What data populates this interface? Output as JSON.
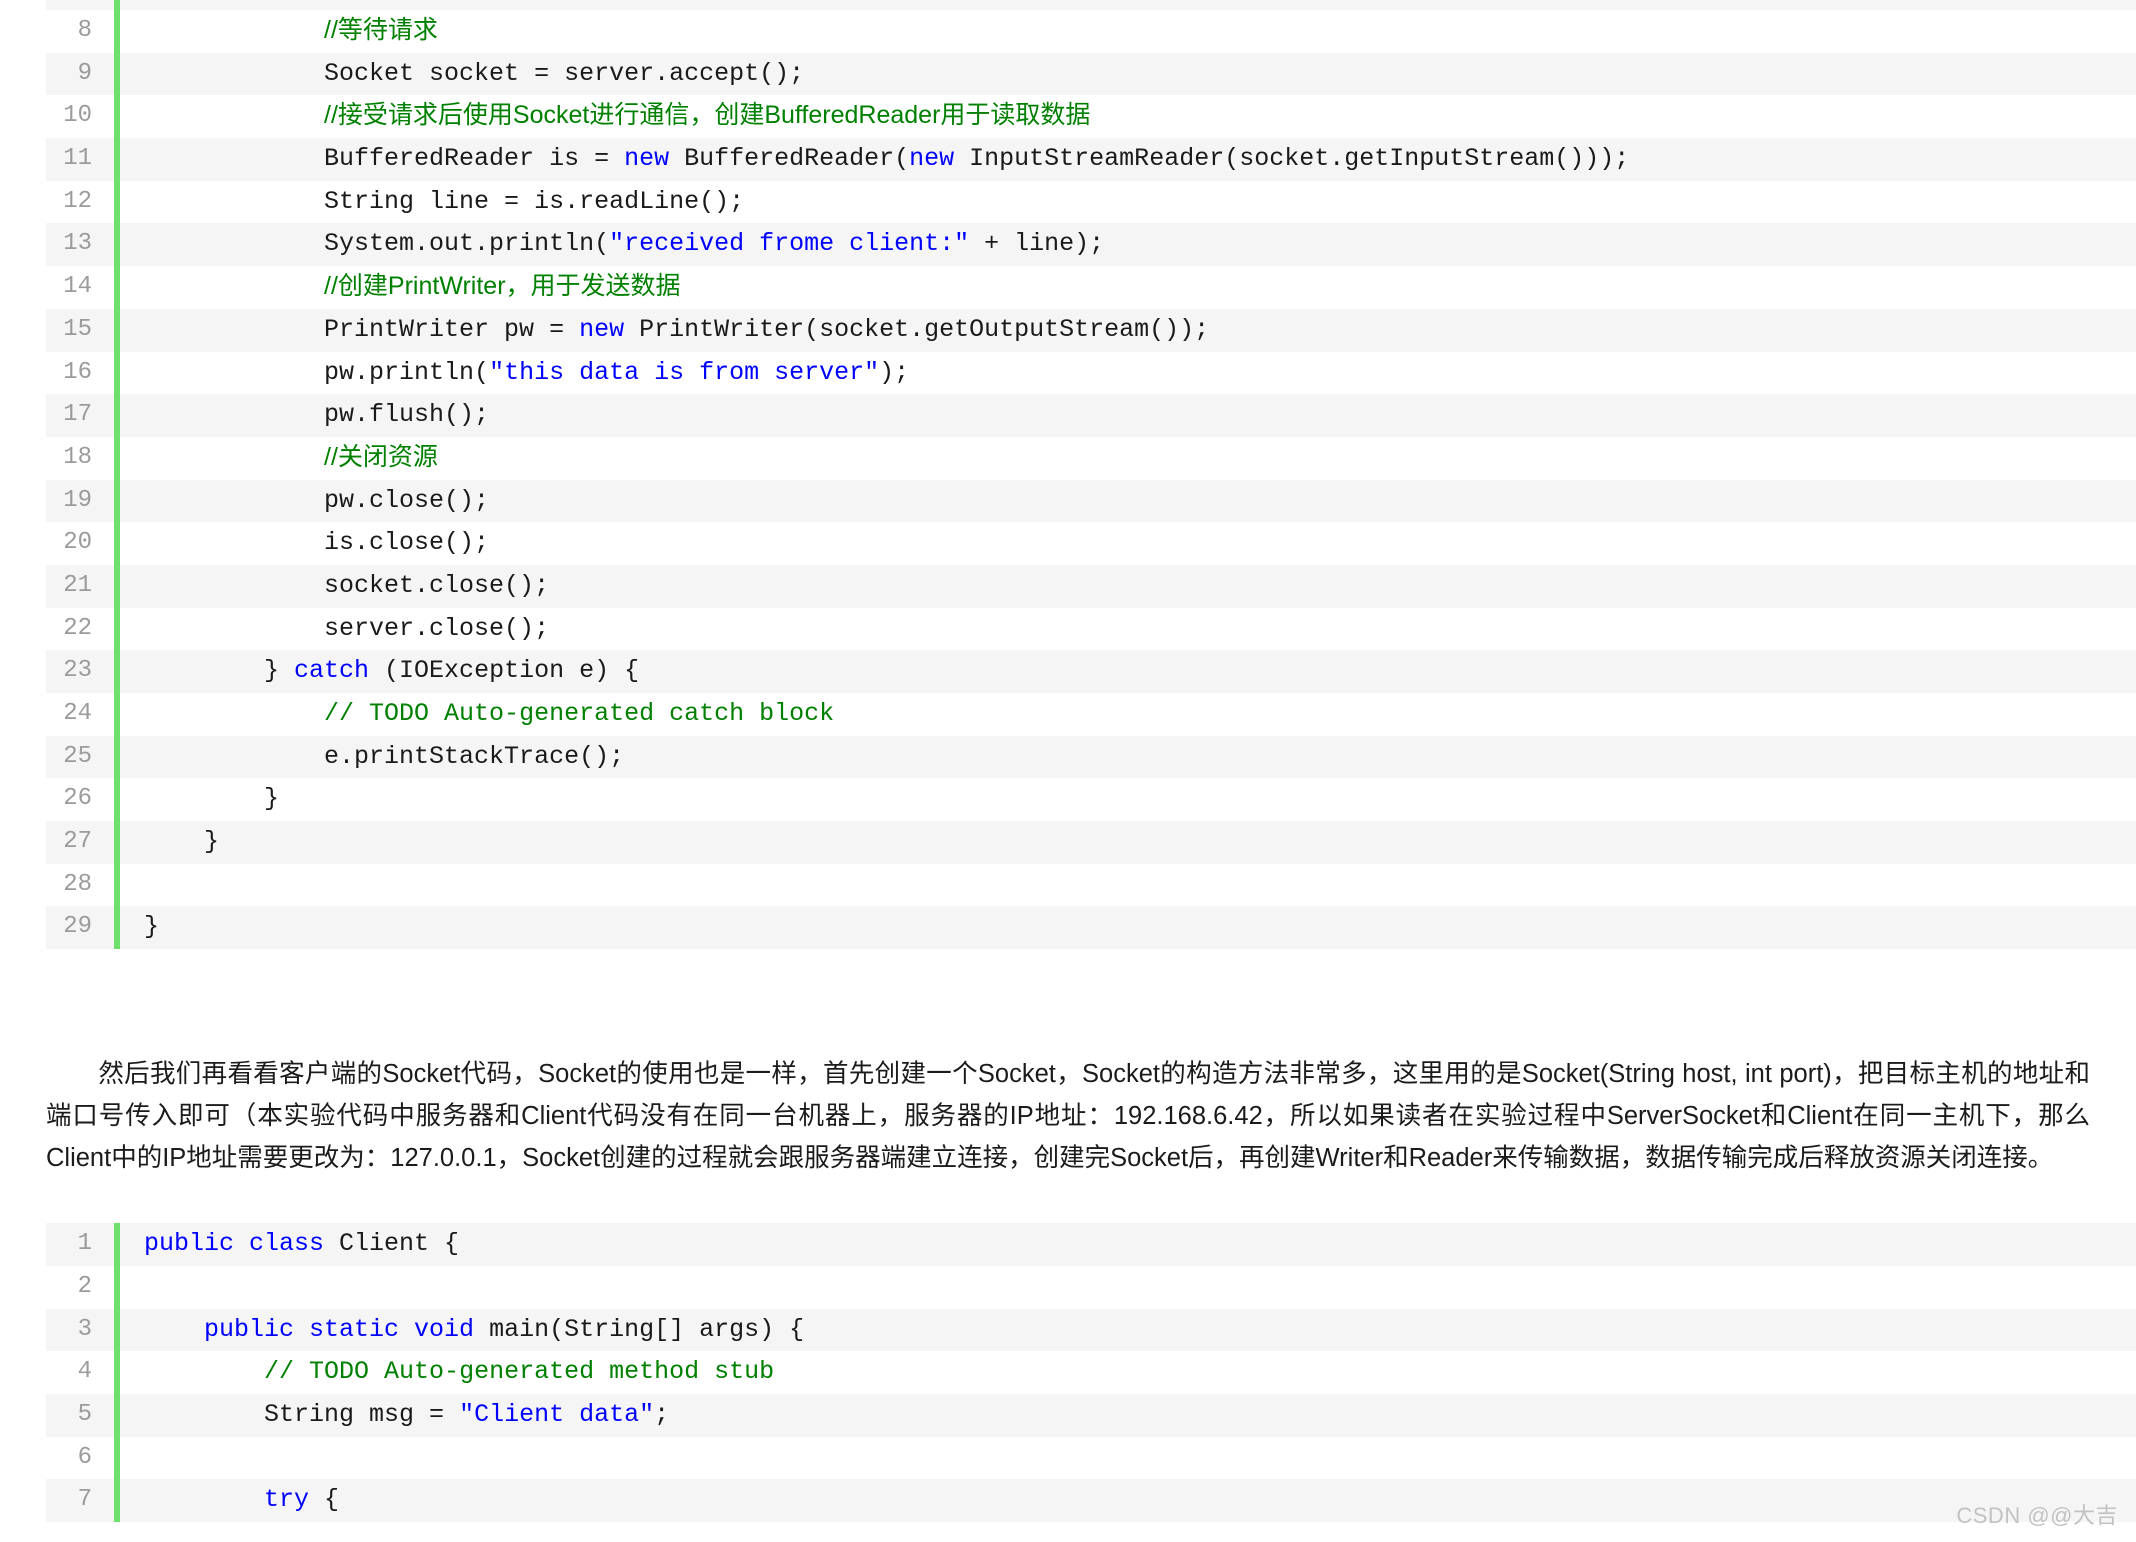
{
  "document": {
    "watermark": "CSDN @@大吉"
  },
  "code_block_server": {
    "language": "java",
    "clipped_top_line": true,
    "lines": [
      {
        "num": "8",
        "segments": [
          {
            "t": "            ",
            "c": "plain"
          },
          {
            "t": "//等待请求",
            "c": "cmt-cn"
          }
        ]
      },
      {
        "num": "9",
        "segments": [
          {
            "t": "            Socket socket = server.accept();",
            "c": "plain"
          }
        ]
      },
      {
        "num": "10",
        "segments": [
          {
            "t": "            ",
            "c": "plain"
          },
          {
            "t": "//接受请求后使用Socket进行通信，创建BufferedReader用于读取数据",
            "c": "cmt-cn"
          }
        ]
      },
      {
        "num": "11",
        "segments": [
          {
            "t": "            BufferedReader is = ",
            "c": "plain"
          },
          {
            "t": "new",
            "c": "kw"
          },
          {
            "t": " BufferedReader(",
            "c": "plain"
          },
          {
            "t": "new",
            "c": "kw"
          },
          {
            "t": " InputStreamReader(socket.getInputStream()));",
            "c": "plain"
          }
        ]
      },
      {
        "num": "12",
        "segments": [
          {
            "t": "            String line = is.readLine();",
            "c": "plain"
          }
        ]
      },
      {
        "num": "13",
        "segments": [
          {
            "t": "            System.out.println(",
            "c": "plain"
          },
          {
            "t": "\"received frome client:\"",
            "c": "str"
          },
          {
            "t": " + line);",
            "c": "plain"
          }
        ]
      },
      {
        "num": "14",
        "segments": [
          {
            "t": "            ",
            "c": "plain"
          },
          {
            "t": "//创建PrintWriter，用于发送数据",
            "c": "cmt-cn"
          }
        ]
      },
      {
        "num": "15",
        "segments": [
          {
            "t": "            PrintWriter pw = ",
            "c": "plain"
          },
          {
            "t": "new",
            "c": "kw"
          },
          {
            "t": " PrintWriter(socket.getOutputStream());",
            "c": "plain"
          }
        ]
      },
      {
        "num": "16",
        "segments": [
          {
            "t": "            pw.println(",
            "c": "plain"
          },
          {
            "t": "\"this data is from server\"",
            "c": "str"
          },
          {
            "t": ");",
            "c": "plain"
          }
        ]
      },
      {
        "num": "17",
        "segments": [
          {
            "t": "            pw.flush();",
            "c": "plain"
          }
        ]
      },
      {
        "num": "18",
        "segments": [
          {
            "t": "            ",
            "c": "plain"
          },
          {
            "t": "//关闭资源",
            "c": "cmt-cn"
          }
        ]
      },
      {
        "num": "19",
        "segments": [
          {
            "t": "            pw.close();",
            "c": "plain"
          }
        ]
      },
      {
        "num": "20",
        "segments": [
          {
            "t": "            is.close();",
            "c": "plain"
          }
        ]
      },
      {
        "num": "21",
        "segments": [
          {
            "t": "            socket.close();",
            "c": "plain"
          }
        ]
      },
      {
        "num": "22",
        "segments": [
          {
            "t": "            server.close();",
            "c": "plain"
          }
        ]
      },
      {
        "num": "23",
        "segments": [
          {
            "t": "        } ",
            "c": "plain"
          },
          {
            "t": "catch",
            "c": "kw"
          },
          {
            "t": " (IOException e) {",
            "c": "plain"
          }
        ]
      },
      {
        "num": "24",
        "segments": [
          {
            "t": "            ",
            "c": "plain"
          },
          {
            "t": "// TODO Auto-generated catch block",
            "c": "cmt"
          }
        ]
      },
      {
        "num": "25",
        "segments": [
          {
            "t": "            e.printStackTrace();",
            "c": "plain"
          }
        ]
      },
      {
        "num": "26",
        "segments": [
          {
            "t": "        }",
            "c": "plain"
          }
        ]
      },
      {
        "num": "27",
        "segments": [
          {
            "t": "    }",
            "c": "plain"
          }
        ]
      },
      {
        "num": "28",
        "segments": [
          {
            "t": "",
            "c": "plain"
          }
        ]
      },
      {
        "num": "29",
        "segments": [
          {
            "t": "}",
            "c": "plain"
          }
        ]
      }
    ]
  },
  "paragraph": {
    "indent": true,
    "text": "然后我们再看看客户端的Socket代码，Socket的使用也是一样，首先创建一个Socket，Socket的构造方法非常多，这里用的是Socket(String host, int port)，把目标主机的地址和端口号传入即可（本实验代码中服务器和Client代码没有在同一台机器上，服务器的IP地址：192.168.6.42，所以如果读者在实验过程中ServerSocket和Client在同一主机下，那么Client中的IP地址需要更改为：127.0.0.1，Socket创建的过程就会跟服务器端建立连接，创建完Socket后，再创建Writer和Reader来传输数据，数据传输完成后释放资源关闭连接。"
  },
  "code_block_client": {
    "language": "java",
    "lines": [
      {
        "num": "1",
        "segments": [
          {
            "t": "",
            "c": "plain"
          },
          {
            "t": "public class",
            "c": "kw"
          },
          {
            "t": " Client {",
            "c": "plain"
          }
        ]
      },
      {
        "num": "2",
        "segments": [
          {
            "t": "",
            "c": "plain"
          }
        ]
      },
      {
        "num": "3",
        "segments": [
          {
            "t": "    ",
            "c": "plain"
          },
          {
            "t": "public static void",
            "c": "kw"
          },
          {
            "t": " main(String[] args) {",
            "c": "plain"
          }
        ]
      },
      {
        "num": "4",
        "segments": [
          {
            "t": "        ",
            "c": "plain"
          },
          {
            "t": "// TODO Auto-generated method stub",
            "c": "cmt"
          }
        ]
      },
      {
        "num": "5",
        "segments": [
          {
            "t": "        String msg = ",
            "c": "plain"
          },
          {
            "t": "\"Client data\"",
            "c": "str"
          },
          {
            "t": ";",
            "c": "plain"
          }
        ]
      },
      {
        "num": "6",
        "segments": [
          {
            "t": "",
            "c": "plain"
          }
        ]
      },
      {
        "num": "7",
        "segments": [
          {
            "t": "        ",
            "c": "plain"
          },
          {
            "t": "try",
            "c": "kw"
          },
          {
            "t": " {",
            "c": "plain"
          }
        ]
      }
    ]
  },
  "colors": {
    "keyword": "#0000ff",
    "string": "#0000ff",
    "comment": "#008000",
    "rail": "#6ce26c",
    "row_alt": "#f5f5f5",
    "gutter_text": "#9b9b9b",
    "watermark": "#c2c2c2"
  }
}
